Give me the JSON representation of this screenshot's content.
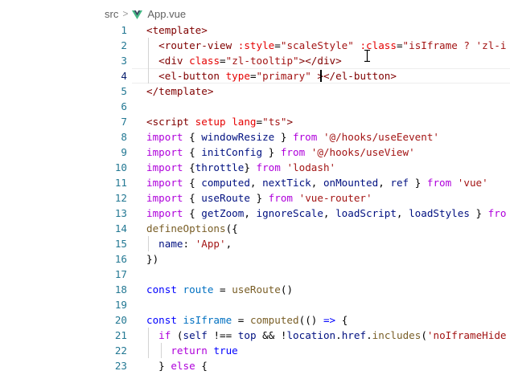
{
  "breadcrumb": {
    "folder": "src",
    "separator": ">",
    "file": "App.vue"
  },
  "colors": {
    "line_number": "#237893",
    "keyword": "#0000ff",
    "control_keyword": "#af00db",
    "string": "#a31515",
    "tag": "#800000",
    "attribute": "#e50000",
    "variable": "#001080",
    "function": "#795e26"
  },
  "editor": {
    "active_line": 4,
    "lines": [
      {
        "n": "1",
        "tokens": [
          {
            "c": "t-tag",
            "t": "<template>"
          }
        ]
      },
      {
        "n": "2",
        "tokens": [
          {
            "c": "t-op",
            "t": "  "
          },
          {
            "c": "t-tag",
            "t": "<router-view"
          },
          {
            "c": "t-op",
            "t": " "
          },
          {
            "c": "t-attr",
            "t": ":style"
          },
          {
            "c": "t-op",
            "t": "="
          },
          {
            "c": "t-str",
            "t": "\"scaleStyle\""
          },
          {
            "c": "t-op",
            "t": " "
          },
          {
            "c": "t-attr",
            "t": ":class"
          },
          {
            "c": "t-op",
            "t": "="
          },
          {
            "c": "t-str",
            "t": "\"isIframe ? 'zl-i"
          }
        ]
      },
      {
        "n": "3",
        "tokens": [
          {
            "c": "t-op",
            "t": "  "
          },
          {
            "c": "t-tag",
            "t": "<div"
          },
          {
            "c": "t-op",
            "t": " "
          },
          {
            "c": "t-attr",
            "t": "class"
          },
          {
            "c": "t-op",
            "t": "="
          },
          {
            "c": "t-str",
            "t": "\"zl-tooltip\""
          },
          {
            "c": "t-tag",
            "t": "></div>"
          }
        ]
      },
      {
        "n": "4",
        "tokens": [
          {
            "c": "t-op",
            "t": "  "
          },
          {
            "c": "t-tag",
            "t": "<el-button"
          },
          {
            "c": "t-op",
            "t": " "
          },
          {
            "c": "t-attr",
            "t": "type"
          },
          {
            "c": "t-op",
            "t": "="
          },
          {
            "c": "t-str",
            "t": "\"primary\""
          },
          {
            "c": "t-op",
            "t": " "
          },
          {
            "c": "t-tag",
            "t": "></el-button>"
          }
        ]
      },
      {
        "n": "5",
        "tokens": [
          {
            "c": "t-tag",
            "t": "</template>"
          }
        ]
      },
      {
        "n": "6",
        "tokens": []
      },
      {
        "n": "7",
        "tokens": [
          {
            "c": "t-tag",
            "t": "<script"
          },
          {
            "c": "t-op",
            "t": " "
          },
          {
            "c": "t-attr",
            "t": "setup"
          },
          {
            "c": "t-op",
            "t": " "
          },
          {
            "c": "t-attr",
            "t": "lang"
          },
          {
            "c": "t-op",
            "t": "="
          },
          {
            "c": "t-str",
            "t": "\"ts\""
          },
          {
            "c": "t-tag",
            "t": ">"
          }
        ]
      },
      {
        "n": "8",
        "tokens": [
          {
            "c": "t-kwc",
            "t": "import"
          },
          {
            "c": "t-op",
            "t": " { "
          },
          {
            "c": "t-var",
            "t": "windowResize"
          },
          {
            "c": "t-op",
            "t": " } "
          },
          {
            "c": "t-kwc",
            "t": "from"
          },
          {
            "c": "t-op",
            "t": " "
          },
          {
            "c": "t-str",
            "t": "'@/hooks/useEevent'"
          }
        ]
      },
      {
        "n": "9",
        "tokens": [
          {
            "c": "t-kwc",
            "t": "import"
          },
          {
            "c": "t-op",
            "t": " { "
          },
          {
            "c": "t-var",
            "t": "initConfig"
          },
          {
            "c": "t-op",
            "t": " } "
          },
          {
            "c": "t-kwc",
            "t": "from"
          },
          {
            "c": "t-op",
            "t": " "
          },
          {
            "c": "t-str",
            "t": "'@/hooks/useView'"
          }
        ]
      },
      {
        "n": "10",
        "tokens": [
          {
            "c": "t-kwc",
            "t": "import"
          },
          {
            "c": "t-op",
            "t": " {"
          },
          {
            "c": "t-var",
            "t": "throttle"
          },
          {
            "c": "t-op",
            "t": "} "
          },
          {
            "c": "t-kwc",
            "t": "from"
          },
          {
            "c": "t-op",
            "t": " "
          },
          {
            "c": "t-str",
            "t": "'lodash'"
          }
        ]
      },
      {
        "n": "11",
        "tokens": [
          {
            "c": "t-kwc",
            "t": "import"
          },
          {
            "c": "t-op",
            "t": " { "
          },
          {
            "c": "t-var",
            "t": "computed"
          },
          {
            "c": "t-op",
            "t": ", "
          },
          {
            "c": "t-var",
            "t": "nextTick"
          },
          {
            "c": "t-op",
            "t": ", "
          },
          {
            "c": "t-var",
            "t": "onMounted"
          },
          {
            "c": "t-op",
            "t": ", "
          },
          {
            "c": "t-var",
            "t": "ref"
          },
          {
            "c": "t-op",
            "t": " } "
          },
          {
            "c": "t-kwc",
            "t": "from"
          },
          {
            "c": "t-op",
            "t": " "
          },
          {
            "c": "t-str",
            "t": "'vue'"
          }
        ]
      },
      {
        "n": "12",
        "tokens": [
          {
            "c": "t-kwc",
            "t": "import"
          },
          {
            "c": "t-op",
            "t": " { "
          },
          {
            "c": "t-var",
            "t": "useRoute"
          },
          {
            "c": "t-op",
            "t": " } "
          },
          {
            "c": "t-kwc",
            "t": "from"
          },
          {
            "c": "t-op",
            "t": " "
          },
          {
            "c": "t-str",
            "t": "'vue-router'"
          }
        ]
      },
      {
        "n": "13",
        "tokens": [
          {
            "c": "t-kwc",
            "t": "import"
          },
          {
            "c": "t-op",
            "t": " { "
          },
          {
            "c": "t-var",
            "t": "getZoom"
          },
          {
            "c": "t-op",
            "t": ", "
          },
          {
            "c": "t-var",
            "t": "ignoreScale"
          },
          {
            "c": "t-op",
            "t": ", "
          },
          {
            "c": "t-var",
            "t": "loadScript"
          },
          {
            "c": "t-op",
            "t": ", "
          },
          {
            "c": "t-var",
            "t": "loadStyles"
          },
          {
            "c": "t-op",
            "t": " } "
          },
          {
            "c": "t-kwc",
            "t": "fro"
          }
        ]
      },
      {
        "n": "14",
        "tokens": [
          {
            "c": "t-fn",
            "t": "defineOptions"
          },
          {
            "c": "t-op",
            "t": "({"
          }
        ]
      },
      {
        "n": "15",
        "tokens": [
          {
            "c": "t-op",
            "t": "  "
          },
          {
            "c": "t-var",
            "t": "name"
          },
          {
            "c": "t-op",
            "t": ": "
          },
          {
            "c": "t-str",
            "t": "'App'"
          },
          {
            "c": "t-op",
            "t": ","
          }
        ]
      },
      {
        "n": "16",
        "tokens": [
          {
            "c": "t-op",
            "t": "})"
          }
        ]
      },
      {
        "n": "17",
        "tokens": []
      },
      {
        "n": "18",
        "tokens": [
          {
            "c": "t-kw",
            "t": "const"
          },
          {
            "c": "t-op",
            "t": " "
          },
          {
            "c": "t-const",
            "t": "route"
          },
          {
            "c": "t-op",
            "t": " = "
          },
          {
            "c": "t-fn",
            "t": "useRoute"
          },
          {
            "c": "t-op",
            "t": "()"
          }
        ]
      },
      {
        "n": "19",
        "tokens": []
      },
      {
        "n": "20",
        "tokens": [
          {
            "c": "t-kw",
            "t": "const"
          },
          {
            "c": "t-op",
            "t": " "
          },
          {
            "c": "t-const",
            "t": "isIframe"
          },
          {
            "c": "t-op",
            "t": " = "
          },
          {
            "c": "t-fn",
            "t": "computed"
          },
          {
            "c": "t-op",
            "t": "(() "
          },
          {
            "c": "t-kw",
            "t": "=>"
          },
          {
            "c": "t-op",
            "t": " {"
          }
        ]
      },
      {
        "n": "21",
        "tokens": [
          {
            "c": "t-op",
            "t": "  "
          },
          {
            "c": "t-kwc",
            "t": "if"
          },
          {
            "c": "t-op",
            "t": " ("
          },
          {
            "c": "t-var",
            "t": "self"
          },
          {
            "c": "t-op",
            "t": " !== "
          },
          {
            "c": "t-var",
            "t": "top"
          },
          {
            "c": "t-op",
            "t": " && !"
          },
          {
            "c": "t-var",
            "t": "location"
          },
          {
            "c": "t-op",
            "t": "."
          },
          {
            "c": "t-var",
            "t": "href"
          },
          {
            "c": "t-op",
            "t": "."
          },
          {
            "c": "t-fn",
            "t": "includes"
          },
          {
            "c": "t-op",
            "t": "("
          },
          {
            "c": "t-str",
            "t": "'noIframeHide"
          }
        ]
      },
      {
        "n": "22",
        "tokens": [
          {
            "c": "t-op",
            "t": "    "
          },
          {
            "c": "t-kwc",
            "t": "return"
          },
          {
            "c": "t-op",
            "t": " "
          },
          {
            "c": "t-kw",
            "t": "true"
          }
        ]
      },
      {
        "n": "23",
        "tokens": [
          {
            "c": "t-op",
            "t": "  } "
          },
          {
            "c": "t-kwc",
            "t": "else"
          },
          {
            "c": "t-op",
            "t": " {"
          }
        ]
      }
    ]
  }
}
